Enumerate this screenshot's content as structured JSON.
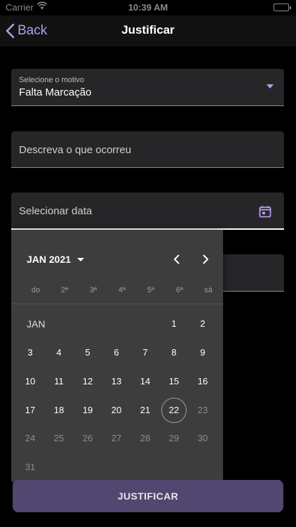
{
  "status_bar": {
    "carrier": "Carrier",
    "time": "10:39 AM"
  },
  "nav": {
    "back_label": "Back",
    "title": "Justificar"
  },
  "form": {
    "reason_label": "Selecione o motivo",
    "reason_value": "Falta Marcação",
    "description_placeholder": "Descreva o que ocorreu",
    "date_placeholder": "Selecionar data",
    "submit_label": "JUSTIFICAR"
  },
  "calendar": {
    "month_year": "JAN 2021",
    "month_label": "JAN",
    "weekdays": [
      "do",
      "2ª",
      "3ª",
      "4ª",
      "5ª",
      "6ª",
      "sá"
    ],
    "selected_day": 22,
    "rows": [
      [
        "",
        "",
        "",
        "",
        "",
        "1",
        "2"
      ],
      [
        "3",
        "4",
        "5",
        "6",
        "7",
        "8",
        "9"
      ],
      [
        "10",
        "11",
        "12",
        "13",
        "14",
        "15",
        "16"
      ],
      [
        "17",
        "18",
        "19",
        "20",
        "21",
        "22",
        "23"
      ],
      [
        "24",
        "25",
        "26",
        "27",
        "28",
        "29",
        "30"
      ],
      [
        "31",
        "",
        "",
        "",
        "",
        "",
        ""
      ]
    ],
    "disabled_from": 23
  },
  "colors": {
    "accent": "#b79cf0",
    "button": "#514770",
    "calendar_bg": "#3d3d3d"
  }
}
